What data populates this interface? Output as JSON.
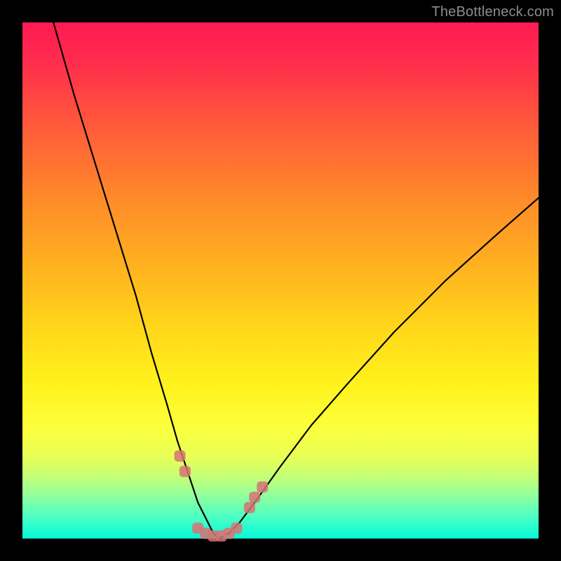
{
  "watermark": {
    "text": "TheBottleneck.com"
  },
  "chart_data": {
    "type": "line",
    "title": "",
    "xlabel": "",
    "ylabel": "",
    "xlim": [
      0,
      100
    ],
    "ylim": [
      0,
      100
    ],
    "grid": false,
    "legend": false,
    "background_gradient": {
      "top": "#ff1a54",
      "bottom": "#06f7d6"
    },
    "series": [
      {
        "name": "curve-left",
        "x": [
          6,
          10,
          14,
          18,
          22,
          25,
          28,
          30,
          32,
          34,
          35,
          36,
          37,
          38
        ],
        "y": [
          100,
          86,
          73,
          60,
          47,
          36,
          26,
          19,
          13,
          7,
          5,
          3,
          1,
          0
        ]
      },
      {
        "name": "curve-right",
        "x": [
          38,
          40,
          42,
          45,
          50,
          56,
          63,
          72,
          82,
          92,
          100
        ],
        "y": [
          0,
          1,
          3,
          7,
          14,
          22,
          30,
          40,
          50,
          59,
          66
        ]
      }
    ],
    "markers": {
      "name": "highlight-points",
      "color": "#d77373",
      "points": [
        {
          "x": 30.5,
          "y": 16
        },
        {
          "x": 31.5,
          "y": 13
        },
        {
          "x": 34.0,
          "y": 2
        },
        {
          "x": 35.5,
          "y": 1
        },
        {
          "x": 37.0,
          "y": 0.5
        },
        {
          "x": 38.5,
          "y": 0.5
        },
        {
          "x": 40.0,
          "y": 1
        },
        {
          "x": 41.5,
          "y": 2
        },
        {
          "x": 44.0,
          "y": 6
        },
        {
          "x": 45.0,
          "y": 8
        },
        {
          "x": 46.5,
          "y": 10
        }
      ]
    }
  }
}
